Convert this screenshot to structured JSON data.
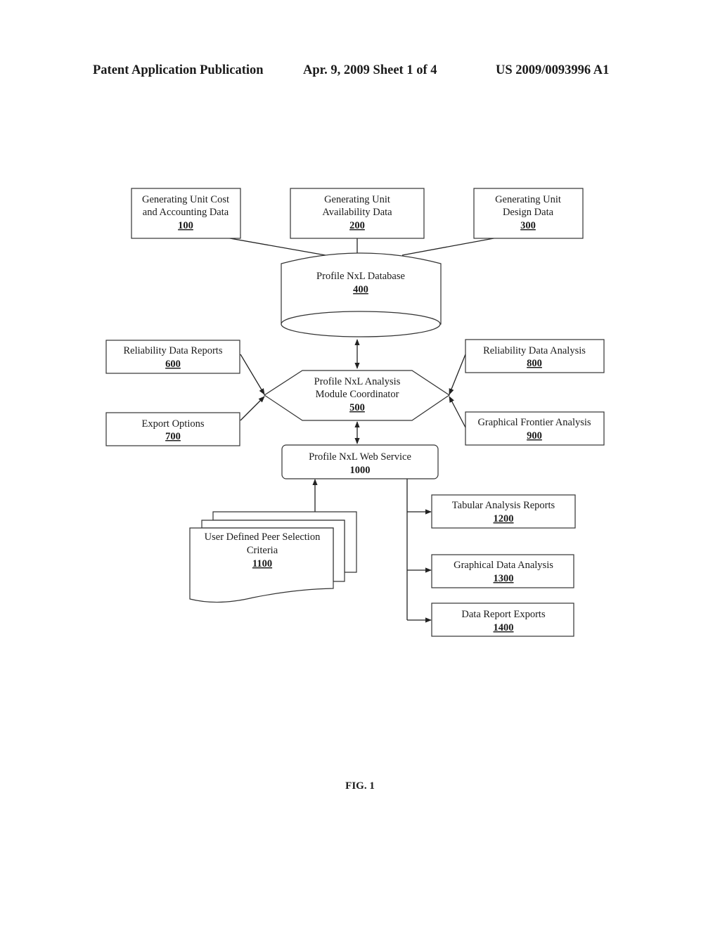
{
  "header": {
    "left": "Patent Application Publication",
    "center": "Apr. 9, 2009   Sheet 1 of 4",
    "right": "US 2009/0093996 A1"
  },
  "nodes": {
    "n100": {
      "lines": [
        "Generating Unit Cost",
        "and Accounting Data"
      ],
      "number": "100"
    },
    "n200": {
      "lines": [
        "Generating Unit",
        "Availability Data"
      ],
      "number": "200"
    },
    "n300": {
      "lines": [
        "Generating Unit",
        "Design Data"
      ],
      "number": "300"
    },
    "n400": {
      "lines": [
        "Profile NxL Database"
      ],
      "number": "400"
    },
    "n500": {
      "lines": [
        "Profile NxL Analysis",
        "Module Coordinator"
      ],
      "number": "500"
    },
    "n600": {
      "lines": [
        "Reliability Data Reports"
      ],
      "number": "600"
    },
    "n700": {
      "lines": [
        "Export Options"
      ],
      "number": "700"
    },
    "n800": {
      "lines": [
        "Reliability Data Analysis"
      ],
      "number": "800"
    },
    "n900": {
      "lines": [
        "Graphical Frontier Analysis"
      ],
      "number": "900"
    },
    "n1000": {
      "lines": [
        "Profile NxL Web Service"
      ],
      "number": "1000"
    },
    "n1100": {
      "lines": [
        "User Defined Peer Selection",
        "Criteria"
      ],
      "number": "1100"
    },
    "n1200": {
      "lines": [
        "Tabular Analysis Reports"
      ],
      "number": "1200"
    },
    "n1300": {
      "lines": [
        "Graphical Data Analysis"
      ],
      "number": "1300"
    },
    "n1400": {
      "lines": [
        "Data Report Exports"
      ],
      "number": "1400"
    }
  },
  "edges": [
    {
      "from": "100",
      "to": "400",
      "arrow": "none"
    },
    {
      "from": "200",
      "to": "400",
      "arrow": "none"
    },
    {
      "from": "300",
      "to": "400",
      "arrow": "none"
    },
    {
      "from": "400",
      "to": "500",
      "arrow": "both"
    },
    {
      "from": "600",
      "to": "500",
      "arrow": "end"
    },
    {
      "from": "700",
      "to": "500",
      "arrow": "end"
    },
    {
      "from": "800",
      "to": "500",
      "arrow": "end"
    },
    {
      "from": "900",
      "to": "500",
      "arrow": "end"
    },
    {
      "from": "500",
      "to": "1000",
      "arrow": "both"
    },
    {
      "from": "1100",
      "to": "1000",
      "arrow": "end"
    },
    {
      "from": "1000",
      "to": "1200",
      "arrow": "end"
    },
    {
      "from": "1000",
      "to": "1300",
      "arrow": "end"
    },
    {
      "from": "1000",
      "to": "1400",
      "arrow": "end"
    }
  ],
  "figure_label": "FIG. 1"
}
